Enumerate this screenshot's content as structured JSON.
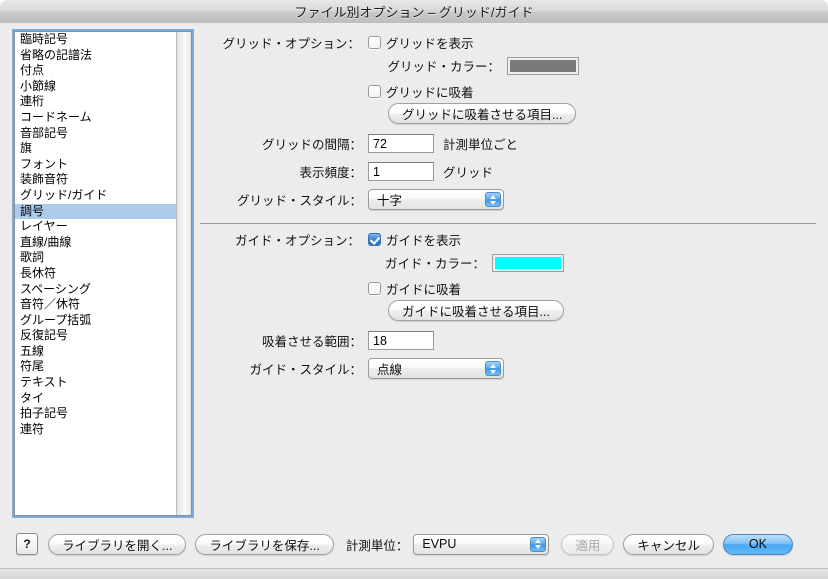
{
  "window": {
    "title": "ファイル別オプション – グリッド/ガイド"
  },
  "sidebar": {
    "selected_index": 11,
    "items": [
      {
        "label": "臨時記号"
      },
      {
        "label": "省略の記譜法"
      },
      {
        "label": "付点"
      },
      {
        "label": "小節線"
      },
      {
        "label": "連桁"
      },
      {
        "label": "コードネーム"
      },
      {
        "label": "音部記号"
      },
      {
        "label": "旗"
      },
      {
        "label": "フォント"
      },
      {
        "label": "装飾音符"
      },
      {
        "label": "グリッド/ガイド"
      },
      {
        "label": "調号"
      },
      {
        "label": "レイヤー"
      },
      {
        "label": "直線/曲線"
      },
      {
        "label": "歌詞"
      },
      {
        "label": "長休符"
      },
      {
        "label": "スペーシング"
      },
      {
        "label": "音符／休符"
      },
      {
        "label": "グループ括弧"
      },
      {
        "label": "反復記号"
      },
      {
        "label": "五線"
      },
      {
        "label": "符尾"
      },
      {
        "label": "テキスト"
      },
      {
        "label": "タイ"
      },
      {
        "label": "拍子記号"
      },
      {
        "label": "連符"
      }
    ]
  },
  "grid_section": {
    "options_label": "グリッド・オプション：",
    "show_grid": {
      "label": "グリッドを表示",
      "checked": false
    },
    "color_label": "グリッド・カラー：",
    "color_value": "#7a7a7a",
    "snap_to_grid": {
      "label": "グリッドに吸着",
      "checked": false
    },
    "snap_items_button": "グリッドに吸着させる項目...",
    "spacing_label": "グリッドの間隔：",
    "spacing_value": "72",
    "spacing_suffix": "計測単位ごと",
    "frequency_label": "表示頻度：",
    "frequency_value": "1",
    "frequency_suffix": "グリッド",
    "style_label": "グリッド・スタイル：",
    "style_value": "十字"
  },
  "guide_section": {
    "options_label": "ガイド・オプション：",
    "show_guide": {
      "label": "ガイドを表示",
      "checked": true
    },
    "color_label": "ガイド・カラー：",
    "color_value": "#00ffff",
    "snap_to_guide": {
      "label": "ガイドに吸着",
      "checked": false
    },
    "snap_items_button": "ガイドに吸着させる項目...",
    "snap_range_label": "吸着させる範囲：",
    "snap_range_value": "18",
    "style_label": "ガイド・スタイル：",
    "style_value": "点線"
  },
  "footer": {
    "help_label": "?",
    "open_library": "ライブラリを開く...",
    "save_library": "ライブラリを保存...",
    "unit_label": "計測単位：",
    "unit_value": "EVPU",
    "apply": "適用",
    "cancel": "キャンセル",
    "ok": "OK"
  }
}
